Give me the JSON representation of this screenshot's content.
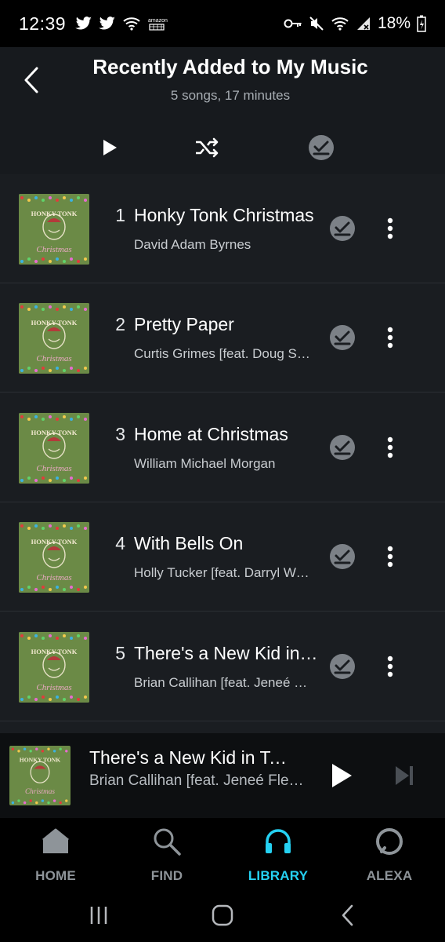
{
  "status_bar": {
    "time": "12:39",
    "battery": "18%",
    "left_icons": [
      "twitter-icon",
      "twitter-icon",
      "wifi-call-icon",
      "amazon-icon"
    ],
    "right_icons": [
      "key-icon",
      "mute-icon",
      "wifi-icon",
      "signal-icon",
      "battery-icon"
    ]
  },
  "header": {
    "title": "Recently Added to My Music",
    "subtitle": "5 songs, 17 minutes"
  },
  "actions": {
    "play": "play-icon",
    "shuffle": "shuffle-icon",
    "download": "download-check-icon"
  },
  "album": {
    "art_top": "HONKY TONK",
    "art_bottom": "Christmas"
  },
  "tracks": [
    {
      "num": "1",
      "title": "Honky Tonk Christmas",
      "artist": "David Adam Byrnes"
    },
    {
      "num": "2",
      "title": "Pretty Paper",
      "artist": "Curtis Grimes [feat. Doug Stone]"
    },
    {
      "num": "3",
      "title": "Home at Christmas",
      "artist": "William Michael Morgan"
    },
    {
      "num": "4",
      "title": "With Bells On",
      "artist": "Holly Tucker [feat. Darryl Worley]"
    },
    {
      "num": "5",
      "title": "There's a New Kid in Town",
      "artist": "Brian Callihan [feat. Jeneé Fleenor]"
    }
  ],
  "now_playing": {
    "title": "There's a New Kid in Town",
    "artist": "Brian Callihan [feat. Jeneé Fleenor]"
  },
  "nav": {
    "home": "HOME",
    "find": "FIND",
    "library": "LIBRARY",
    "alexa": "ALEXA",
    "active": "LIBRARY"
  },
  "colors": {
    "accent": "#25d1f2",
    "header_bg": "#171a1e",
    "list_bg": "#1a1d21",
    "album_green": "#6b8a46"
  }
}
